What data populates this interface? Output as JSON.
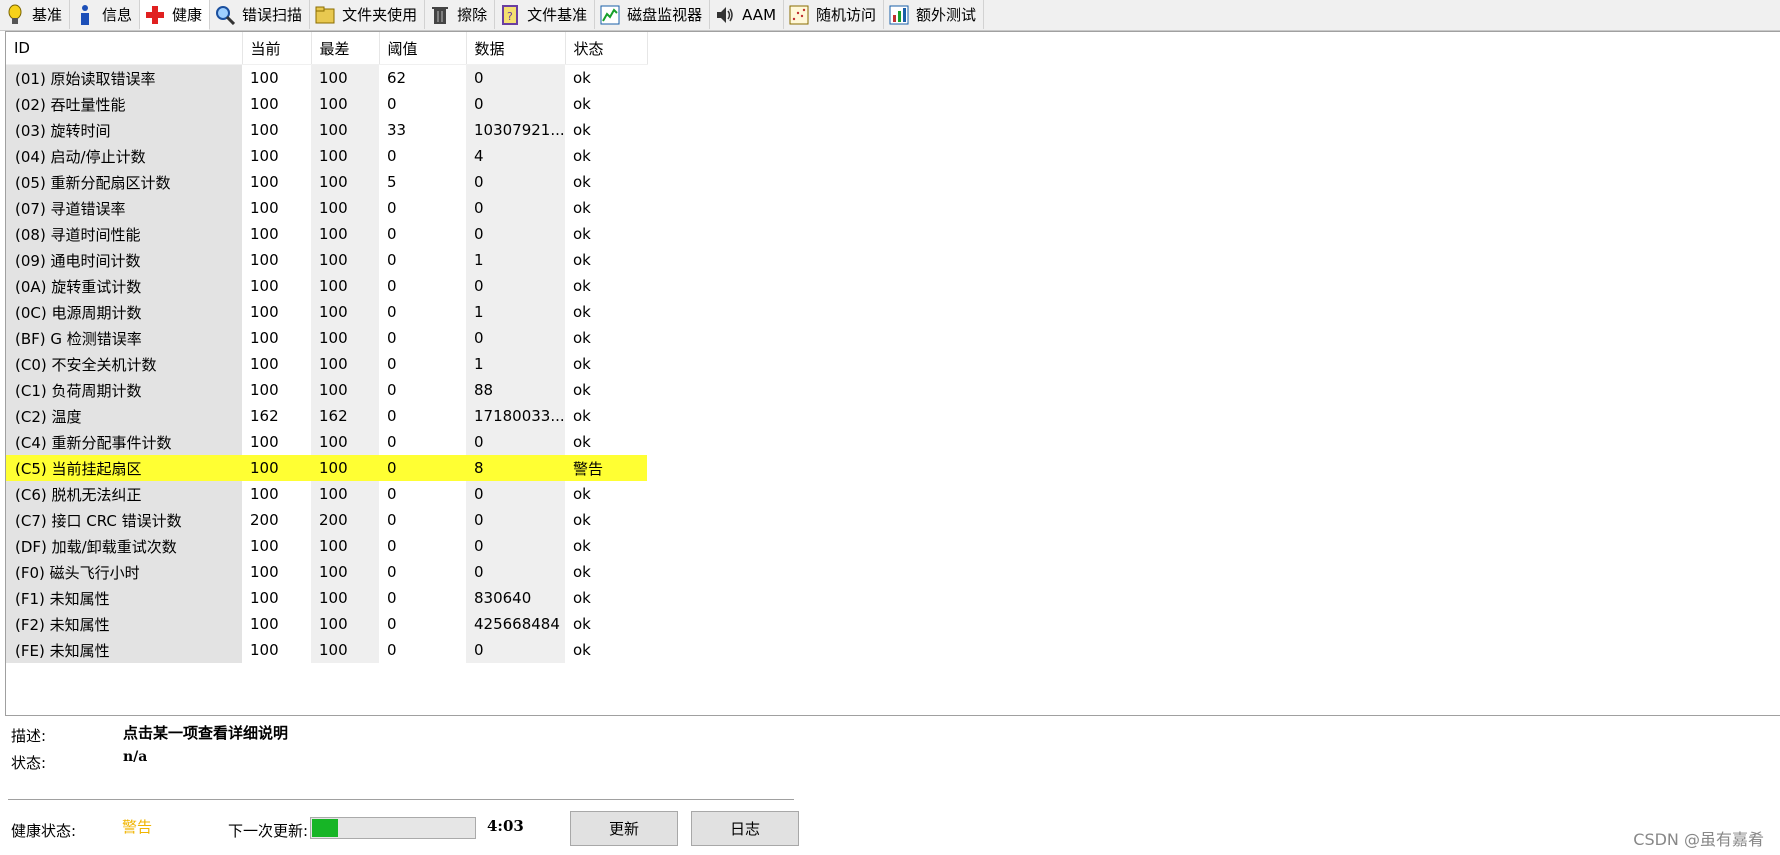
{
  "tabs": [
    {
      "label": "基准",
      "icon": "bulb-icon"
    },
    {
      "label": "信息",
      "icon": "info-icon"
    },
    {
      "label": "健康",
      "icon": "health-cross-icon"
    },
    {
      "label": "错误扫描",
      "icon": "magnifier-icon"
    },
    {
      "label": "文件夹使用",
      "icon": "folder-icon"
    },
    {
      "label": "擦除",
      "icon": "trash-icon"
    },
    {
      "label": "文件基准",
      "icon": "file-benchmark-icon"
    },
    {
      "label": "磁盘监视器",
      "icon": "disk-monitor-icon"
    },
    {
      "label": "AAM",
      "icon": "speaker-icon"
    },
    {
      "label": "随机访问",
      "icon": "random-access-icon"
    },
    {
      "label": "额外测试",
      "icon": "extra-tests-icon"
    }
  ],
  "colors": {
    "active_tab_icon": "#e02020",
    "warning_row": "#ffff33",
    "warning_text": "#f0b400",
    "progress": "#17b526"
  },
  "table": {
    "headers": [
      "ID",
      "当前",
      "最差",
      "阈值",
      "数据",
      "状态"
    ],
    "rows": [
      [
        "(01) 原始读取错误率",
        "100",
        "100",
        "62",
        "0",
        "ok"
      ],
      [
        "(02) 吞吐量性能",
        "100",
        "100",
        "0",
        "0",
        "ok"
      ],
      [
        "(03) 旋转时间",
        "100",
        "100",
        "33",
        "10307921...",
        "ok"
      ],
      [
        "(04) 启动/停止计数",
        "100",
        "100",
        "0",
        "4",
        "ok"
      ],
      [
        "(05) 重新分配扇区计数",
        "100",
        "100",
        "5",
        "0",
        "ok"
      ],
      [
        "(07) 寻道错误率",
        "100",
        "100",
        "0",
        "0",
        "ok"
      ],
      [
        "(08) 寻道时间性能",
        "100",
        "100",
        "0",
        "0",
        "ok"
      ],
      [
        "(09) 通电时间计数",
        "100",
        "100",
        "0",
        "1",
        "ok"
      ],
      [
        "(0A) 旋转重试计数",
        "100",
        "100",
        "0",
        "0",
        "ok"
      ],
      [
        "(0C) 电源周期计数",
        "100",
        "100",
        "0",
        "1",
        "ok"
      ],
      [
        "(BF) G 检测错误率",
        "100",
        "100",
        "0",
        "0",
        "ok"
      ],
      [
        "(C0) 不安全关机计数",
        "100",
        "100",
        "0",
        "1",
        "ok"
      ],
      [
        "(C1) 负荷周期计数",
        "100",
        "100",
        "0",
        "88",
        "ok"
      ],
      [
        "(C2) 温度",
        "162",
        "162",
        "0",
        "17180033...",
        "ok"
      ],
      [
        "(C4) 重新分配事件计数",
        "100",
        "100",
        "0",
        "0",
        "ok"
      ],
      [
        "(C5) 当前挂起扇区",
        "100",
        "100",
        "0",
        "8",
        "警告"
      ],
      [
        "(C6) 脱机无法纠正",
        "100",
        "100",
        "0",
        "0",
        "ok"
      ],
      [
        "(C7) 接口 CRC 错误计数",
        "200",
        "200",
        "0",
        "0",
        "ok"
      ],
      [
        "(DF) 加载/卸载重试次数",
        "100",
        "100",
        "0",
        "0",
        "ok"
      ],
      [
        "(F0) 磁头飞行小时",
        "100",
        "100",
        "0",
        "0",
        "ok"
      ],
      [
        "(F1) 未知属性",
        "100",
        "100",
        "0",
        "830640",
        "ok"
      ],
      [
        "(F2) 未知属性",
        "100",
        "100",
        "0",
        "425668484",
        "ok"
      ],
      [
        "(FE) 未知属性",
        "100",
        "100",
        "0",
        "0",
        "ok"
      ]
    ]
  },
  "details": {
    "desc_label": "描述:",
    "desc_value": "点击某一项查看详细说明",
    "state_label": "状态:",
    "state_value": "n/a"
  },
  "footer": {
    "health_label": "健康状态:",
    "health_value": "警告",
    "next_update_label": "下一次更新:",
    "countdown": "4:03",
    "progress_fraction": 0.16,
    "refresh_button": "更新",
    "log_button": "日志"
  },
  "watermark": "CSDN @虽有嘉肴"
}
